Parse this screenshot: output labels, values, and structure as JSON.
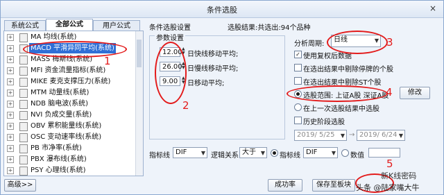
{
  "window": {
    "title": "条件选股",
    "close": "×"
  },
  "tabs": [
    "系统公式",
    "全部公式",
    "用户公式"
  ],
  "formula_list": [
    {
      "label": "MA 均线(系统)",
      "expand": "+"
    },
    {
      "label": "MACD 平滑异同平均(系统)",
      "expand": "+",
      "selected": true
    },
    {
      "label": "MASS 梅斯线(系统)",
      "expand": "+"
    },
    {
      "label": "MFI 资金流量指标(系统)",
      "expand": "+"
    },
    {
      "label": "MIKE 麦克支撑压力(系统)",
      "expand": "+"
    },
    {
      "label": "MTM 动量线(系统)",
      "expand": "+"
    },
    {
      "label": "NDB 脑电波(系统)",
      "expand": "+"
    },
    {
      "label": "NVI 负成交量(系统)",
      "expand": "+"
    },
    {
      "label": "OBV 累积能量线(系统)",
      "expand": "+"
    },
    {
      "label": "OSC 变动速率线(系统)",
      "expand": "+"
    },
    {
      "label": "PB 市净率(系统)",
      "expand": "+"
    },
    {
      "label": "PBX 瀑布线(系统)",
      "expand": "+"
    },
    {
      "label": "PSY 心理线(系统)",
      "expand": "+"
    }
  ],
  "condition": {
    "header": "条件选股设置",
    "result_label": "选股结果:共选出:94个品种",
    "params_group": "参数设置",
    "params": [
      {
        "value": "12.00",
        "label": "日快线移动平均;"
      },
      {
        "value": "26.00",
        "label": "日慢线移动平均;"
      },
      {
        "value": "9.00",
        "label": "日移动平均;"
      }
    ],
    "indicator_label": "指标线",
    "indicator_value": "DIF",
    "logic_label": "逻辑关系",
    "logic_value": "大于",
    "compare_radio_label": "指标线",
    "compare_value": "DIF",
    "number_radio_label": "数值"
  },
  "options": {
    "period_label": "分析周期:",
    "period_value": "日线",
    "use_adjusted": "使用复权后数据",
    "exclude_suspended": "在选出结果中剔除停牌的个股",
    "exclude_st": "在选出结果中剔除ST个股",
    "scope_label": "选股范围: 上证A股 深证A股",
    "modify_button": "修改",
    "prev_result": "在上一次选股结果中选股",
    "history_stage": "历史阶段选股",
    "date_from": "2019/ 5/25",
    "date_to": "2019/ 6/24",
    "date_sep": "→"
  },
  "buttons": {
    "advanced": "高级>>",
    "success_rate": "成功率",
    "save_board": "保存至板块"
  },
  "annotations": [
    "1",
    "2",
    "3",
    "4",
    "5"
  ],
  "watermark": {
    "line1": "新K线密码",
    "line2": "头条 @陆家嘴大牛"
  },
  "colors": {
    "annotation": "#e31b1b",
    "selection": "#2f6fd6"
  }
}
